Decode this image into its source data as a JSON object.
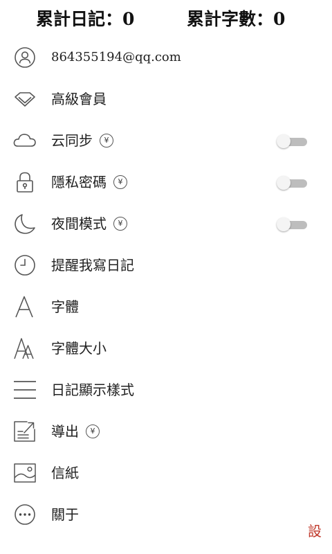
{
  "stats": {
    "diary_count": "累計日記：0",
    "word_count": "累計字數：0"
  },
  "menu": [
    {
      "id": "account",
      "label": "864355194@qq.com",
      "icon": "user-icon",
      "premium": false,
      "toggle": null
    },
    {
      "id": "vip",
      "label": "高級會員",
      "icon": "diamond-icon",
      "premium": false,
      "toggle": null
    },
    {
      "id": "cloud-sync",
      "label": "云同步",
      "icon": "cloud-icon",
      "premium": true,
      "toggle": false
    },
    {
      "id": "privacy-password",
      "label": "隱私密碼",
      "icon": "lock-icon",
      "premium": true,
      "toggle": false
    },
    {
      "id": "night-mode",
      "label": "夜間模式",
      "icon": "moon-icon",
      "premium": true,
      "toggle": false
    },
    {
      "id": "reminder",
      "label": "提醒我寫日記",
      "icon": "clock-icon",
      "premium": false,
      "toggle": null
    },
    {
      "id": "font",
      "label": "字體",
      "icon": "font-icon",
      "premium": false,
      "toggle": null
    },
    {
      "id": "font-size",
      "label": "字體大小",
      "icon": "font-size-icon",
      "premium": false,
      "toggle": null
    },
    {
      "id": "diary-display-style",
      "label": "日記顯示樣式",
      "icon": "list-lines-icon",
      "premium": false,
      "toggle": null
    },
    {
      "id": "export",
      "label": "導出",
      "icon": "export-icon",
      "premium": true,
      "toggle": null
    },
    {
      "id": "stationery",
      "label": "信紙",
      "icon": "image-icon",
      "premium": false,
      "toggle": null
    },
    {
      "id": "about",
      "label": "關于",
      "icon": "more-icon",
      "premium": false,
      "toggle": null
    }
  ],
  "premium_badge": "¥",
  "corner_label": "設",
  "colors": {
    "text": "#202020",
    "icon_stroke": "#555555",
    "toggle_off_track": "#bdbdbd",
    "toggle_knob": "#f4f4f4",
    "corner_label": "#c0392b"
  }
}
